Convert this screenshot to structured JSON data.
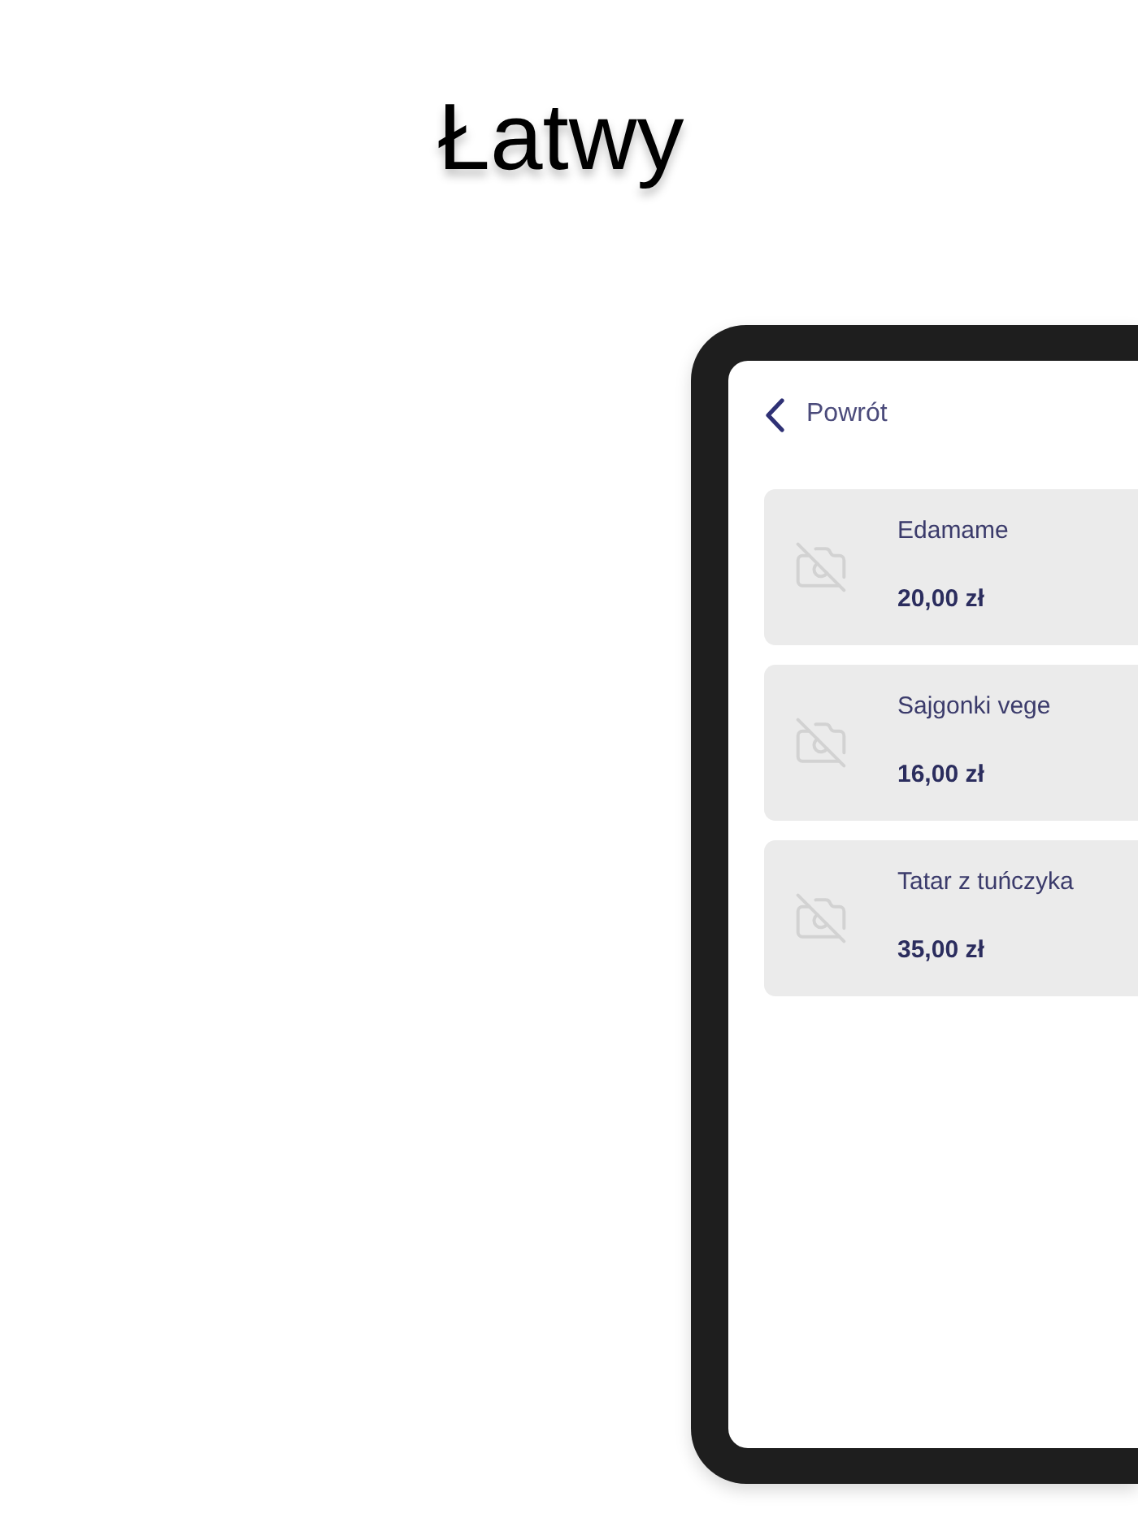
{
  "title": "Łatwy",
  "back_link": {
    "label": "Powrót"
  },
  "items": [
    {
      "name": "Edamame",
      "price": "20,00 zł"
    },
    {
      "name": "Sajgonki vege",
      "price": "16,00 zł"
    },
    {
      "name": "Tatar z tuńczyka",
      "price": "35,00 zł"
    }
  ]
}
